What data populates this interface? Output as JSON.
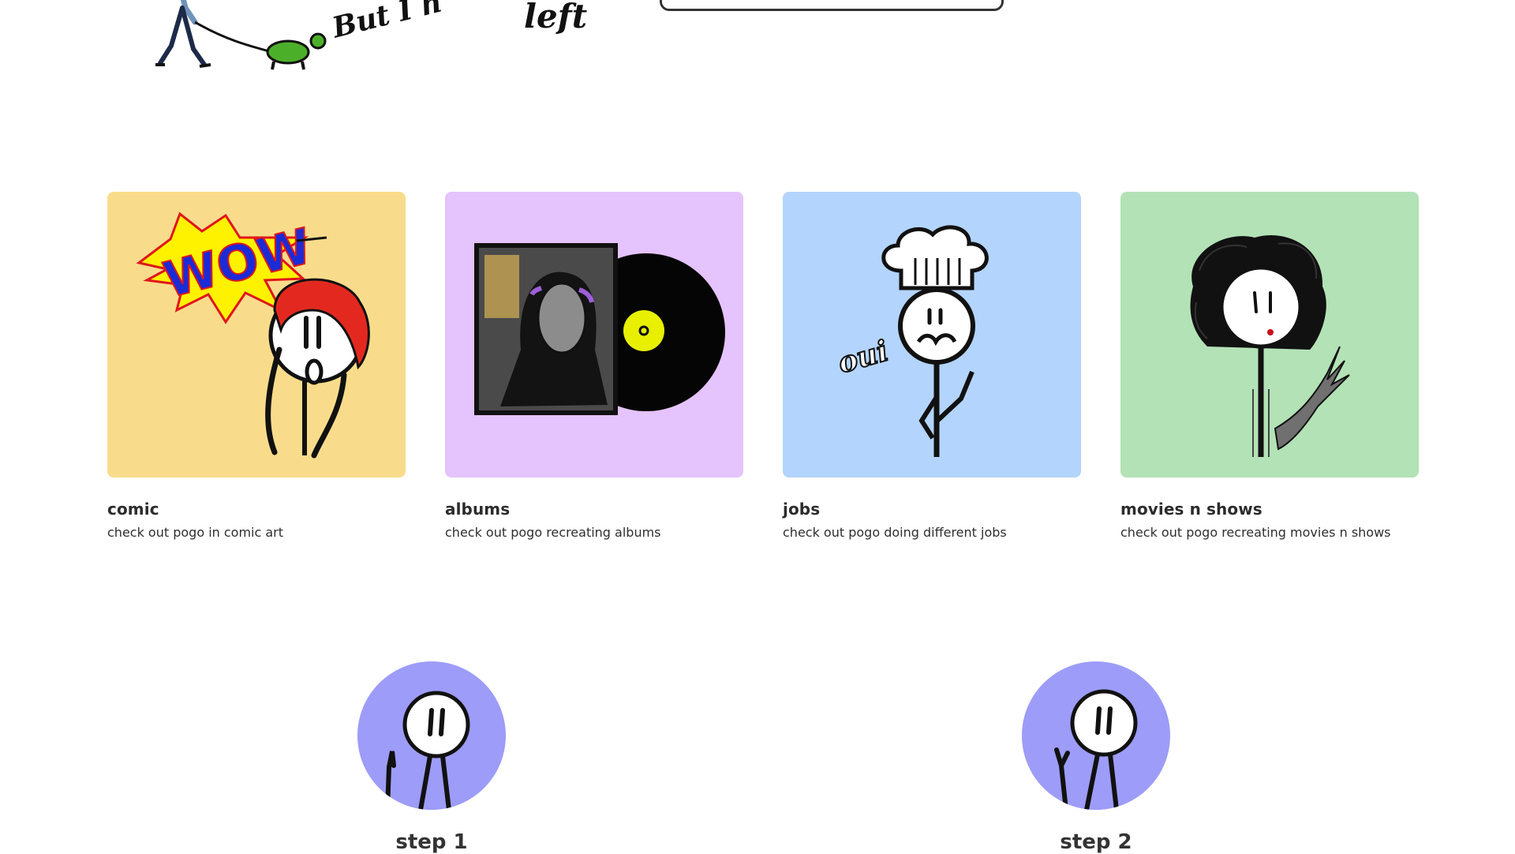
{
  "hero": {
    "scribble_a": "But I h",
    "scribble_b": "left"
  },
  "categories": [
    {
      "title": "comic",
      "description": "check out pogo in comic art",
      "bg": "#f9dc8b",
      "icon": "wow-comic-icon"
    },
    {
      "title": "albums",
      "description": "check out pogo recreating albums",
      "bg": "#e5c3fc",
      "icon": "vinyl-album-icon"
    },
    {
      "title": "jobs",
      "description": "check out pogo doing different jobs",
      "bg": "#b3d4fc",
      "icon": "chef-icon"
    },
    {
      "title": "movies n shows",
      "description": "check out pogo recreating movies n shows",
      "bg": "#b3e2b6",
      "icon": "scissorhands-icon"
    }
  ],
  "steps": [
    {
      "label": "step 1",
      "icon": "stickman-one-finger-icon"
    },
    {
      "label": "step 2",
      "icon": "stickman-two-fingers-icon"
    }
  ],
  "colors": {
    "step_circle": "#9d9cf8",
    "text": "#2c2c2c"
  },
  "art_text": {
    "wow": "WOW",
    "oui": "oui"
  }
}
